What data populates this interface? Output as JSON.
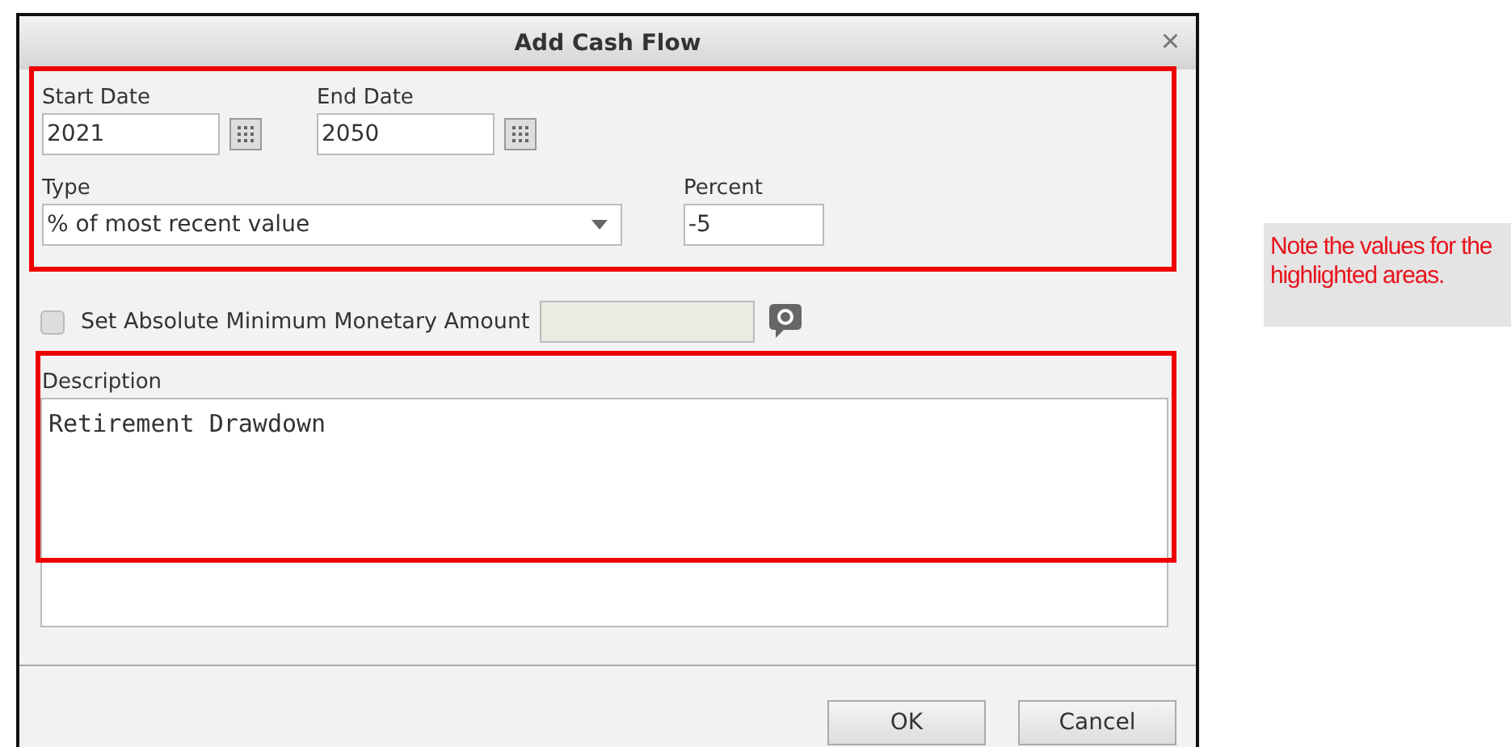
{
  "dialog": {
    "title": "Add Cash Flow",
    "close": "×"
  },
  "start_date": {
    "label": "Start Date",
    "value": "2021"
  },
  "end_date": {
    "label": "End Date",
    "value": "2050"
  },
  "type": {
    "label": "Type",
    "value": "% of most recent value"
  },
  "percent": {
    "label": "Percent",
    "value": "-5"
  },
  "minimum": {
    "label": "Set Absolute Minimum Monetary Amount",
    "checked": false
  },
  "description": {
    "label": "Description",
    "value": "Retirement Drawdown"
  },
  "buttons": [
    "OK",
    "Cancel"
  ],
  "note": "Note the values for the highlighted areas."
}
